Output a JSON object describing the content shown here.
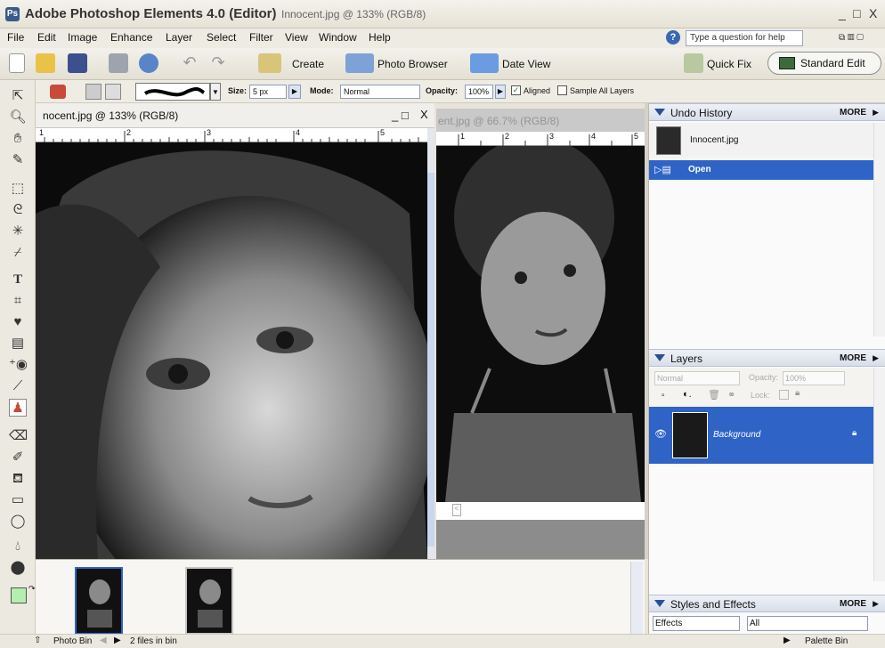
{
  "app": {
    "title": "Adobe Photoshop Elements 4.0 (Editor)",
    "document_title": "Innocent.jpg @ 133% (RGB/8)",
    "window_controls": [
      "_",
      "□",
      "X"
    ]
  },
  "menu": {
    "items": [
      "File",
      "Edit",
      "Image",
      "Enhance",
      "Layer",
      "Select",
      "Filter",
      "View",
      "Window",
      "Help"
    ],
    "help_placeholder": "Type a question for help"
  },
  "toolbar": {
    "create_label": "Create",
    "photo_browser_label": "Photo Browser",
    "date_view_label": "Date View",
    "quick_fix_label": "Quick Fix",
    "standard_edit_label": "Standard Edit"
  },
  "options_bar": {
    "size_label": "Size:",
    "size_value": "5 px",
    "mode_label": "Mode:",
    "mode_value": "Normal",
    "opacity_label": "Opacity:",
    "opacity_value": "100%",
    "aligned_label": "Aligned",
    "aligned_checked": true,
    "sample_all_label": "Sample All Layers",
    "sample_all_checked": false
  },
  "doc_window_1": {
    "title": "nocent.jpg @ 133% (RGB/8)",
    "ruler_ticks": [
      "1",
      "2",
      "3",
      "4",
      "5"
    ]
  },
  "doc_window_2": {
    "title": "ent.jpg @ 66.7% (RGB/8)",
    "ruler_ticks": [
      "1",
      "2",
      "3",
      "4",
      "5"
    ]
  },
  "undo_history": {
    "title": "Undo History",
    "more_label": "MORE",
    "items": [
      "Innocent.jpg",
      "Open"
    ]
  },
  "layers": {
    "title": "Layers",
    "more_label": "MORE",
    "blend_mode": "Normal",
    "opacity_label": "Opacity:",
    "opacity_value": "100%",
    "lock_label": "Lock:",
    "layer_name": "Background"
  },
  "styles": {
    "title": "Styles and Effects",
    "more_label": "MORE",
    "category": "Effects",
    "filter": "All"
  },
  "status": {
    "photo_bin_label": "Photo Bin",
    "files_count": "2 files in bin",
    "palette_bin_label": "Palette Bin"
  },
  "colors": {
    "selection_blue": "#2f64c6",
    "foreground_color": "#b4eeb0",
    "background_color": "#ffffff"
  }
}
